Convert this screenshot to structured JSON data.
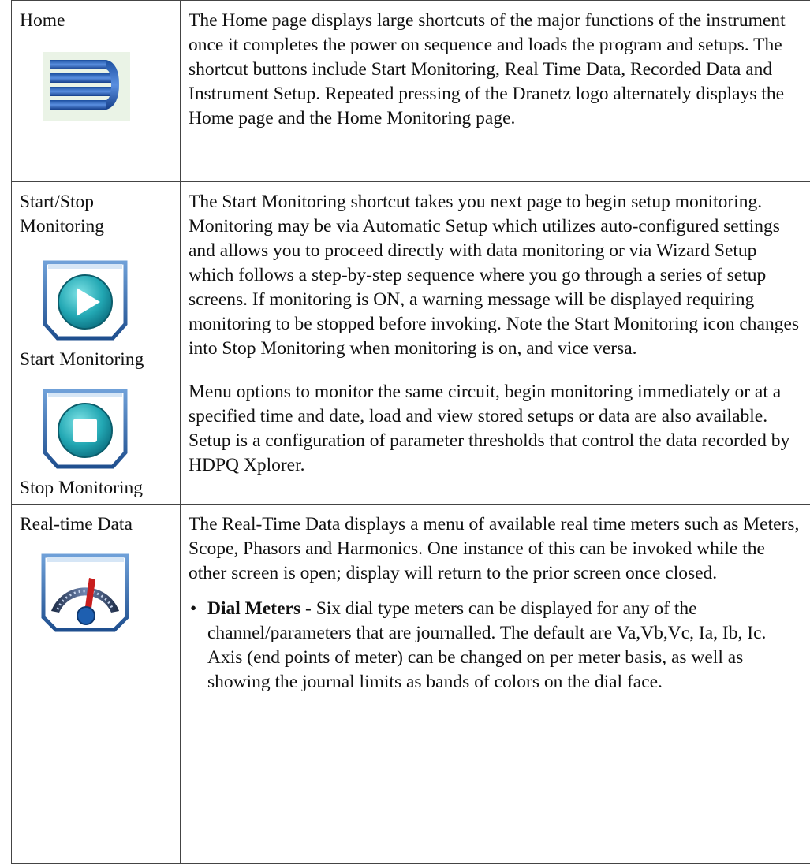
{
  "rows": [
    {
      "name": "Home",
      "icon": "dranetz-logo-icon",
      "text": "The Home page displays large shortcuts of the major functions of the instrument once it completes the power on sequence and loads the program and setups. The shortcut buttons include Start Monitoring, Real Time Data, Recorded Data and Instrument Setup. Repeated pressing of the Dranetz logo alternately displays the Home page and the Home Monitoring page."
    },
    {
      "name": "Start/Stop Monitoring",
      "icon_start": "play-icon",
      "caption_start": "Start Monitoring",
      "icon_stop": "stop-icon",
      "caption_stop": "Stop Monitoring",
      "text": "The Start Monitoring shortcut takes you next page to begin setup monitoring. Monitoring may be via Automatic Setup which utilizes auto-configured settings and allows you to proceed directly with data monitoring or via Wizard Setup which follows a step-by-step sequence where you go through a series of setup screens. If monitoring is ON, a warning message will be displayed requiring monitoring to be stopped before invoking. Note the Start Monitoring icon changes into Stop Monitoring when monitoring is on, and vice versa.",
      "text2": "Menu options to monitor the same circuit, begin monitoring immediately or at a specified time and date, load and view stored setups or data are also available. Setup is a configuration of parameter thresholds that control the data recorded by HDPQ Xplorer."
    },
    {
      "name": "Real-time Data",
      "icon": "gauge-icon",
      "text": "The Real-Time Data displays a menu of available real time meters such as Meters, Scope, Phasors and Harmonics. One instance of this can be invoked while the other screen is open; display will return to the prior screen once closed.",
      "bullet_marker": "•",
      "bullet_title": "Dial Meters",
      "bullet_sep": " - ",
      "bullet_text": "Six dial type meters can be displayed for any of the channel/parameters that are journalled. The default are Va,Vb,Vc, Ia, Ib, Ic. Axis (end points of meter) can be changed on per meter basis, as well as showing the journal limits as bands of colors on the dial face."
    }
  ]
}
